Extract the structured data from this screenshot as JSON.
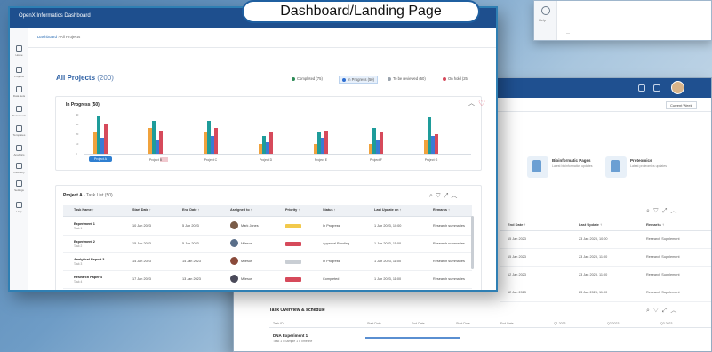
{
  "annotation": {
    "label": "Dashboard/Landing Page"
  },
  "top_window": {
    "side_label": "Help",
    "text_line1": "",
    "text_line2": ""
  },
  "app": {
    "brand": "OpenX Informatics Dashboard",
    "breadcrumb_root": "Dashboard",
    "breadcrumb_current": "All Projects"
  },
  "sidebar": {
    "items": [
      {
        "label": "Home",
        "icon": "home-icon"
      },
      {
        "label": "Projects",
        "icon": "projects-icon"
      },
      {
        "label": "Data Sets",
        "icon": "dataset-icon"
      },
      {
        "label": "Documents",
        "icon": "documents-icon"
      },
      {
        "label": "Templates",
        "icon": "templates-icon"
      },
      {
        "label": "Analytics",
        "icon": "analytics-icon"
      },
      {
        "label": "Inventory",
        "icon": "inventory-icon"
      },
      {
        "label": "Settings",
        "icon": "settings-icon"
      },
      {
        "label": "Help",
        "icon": "help-icon"
      }
    ]
  },
  "main": {
    "title": "All Projects",
    "title_count": "(200)",
    "legend": [
      {
        "label": "Completed (75)",
        "color": "#2e8b57"
      },
      {
        "label": "In Progress (50)",
        "color": "#2f6fd1",
        "active": true
      },
      {
        "label": "To be reviewed (50)",
        "color": "#9aa3ad"
      },
      {
        "label": "On hold (25)",
        "color": "#d64a5b"
      }
    ]
  },
  "chart_data": {
    "type": "bar",
    "title": "In Progress (50)",
    "ylabel": "",
    "categories": [
      "Project A",
      "Project B",
      "Project C",
      "Project D",
      "Project E",
      "Project F",
      "Project G"
    ],
    "series": [
      {
        "color": "#f0a23c",
        "values": [
          22,
          26,
          22,
          10,
          10,
          10,
          15
        ]
      },
      {
        "color": "#1e9c9a",
        "values": [
          38,
          34,
          34,
          18,
          22,
          26,
          37
        ]
      },
      {
        "color": "#3a7bd5",
        "values": [
          16,
          14,
          18,
          12,
          16,
          14,
          18
        ]
      },
      {
        "color": "#d64a5b",
        "values": [
          30,
          24,
          26,
          22,
          24,
          22,
          20
        ]
      }
    ],
    "ylim": [
      0,
      40
    ],
    "yticks": [
      40,
      30,
      20,
      10,
      0
    ],
    "selected_category": "Project A"
  },
  "table": {
    "title": "Project A",
    "title_sub": "- Task List (50)",
    "columns": [
      "Task Name ↑",
      "Start Date ↑",
      "End Date ↑",
      "Assigned to ↑",
      "Priority ↑",
      "Status ↑",
      "Last Update on ↑",
      "Remarks ↑"
    ],
    "rows": [
      {
        "name": "Experiment 1",
        "sub": "Task 1",
        "start": "10 Jan 2023",
        "end": "5 Jan 2023",
        "assignee": "Mark Jones",
        "priority_color": "#f2c94c",
        "status": "In Progress",
        "updated": "1 Jan 2023, 10:00",
        "remarks": "Research summaries",
        "avatar": "#7a5c48"
      },
      {
        "name": "Experiment 2",
        "sub": "Task 2",
        "start": "15 Jan 2023",
        "end": "5 Jan 2023",
        "assignee": "Milesus",
        "priority_color": "#d64a5b",
        "status": "Approval Pending",
        "updated": "1 Jan 2023, 11:00",
        "remarks": "Research summaries",
        "avatar": "#5a6f8a"
      },
      {
        "name": "Analytical Report 3",
        "sub": "Task 3",
        "start": "14 Jan 2023",
        "end": "14 Jan 2023",
        "assignee": "Milesus",
        "priority_color": "#c9ced4",
        "status": "In Progress",
        "updated": "1 Jan 2023, 11:00",
        "remarks": "Research summaries",
        "avatar": "#8a4a3a"
      },
      {
        "name": "Research Paper 4",
        "sub": "Task 4",
        "start": "17 Jan 2023",
        "end": "13 Jan 2023",
        "assignee": "Milesus",
        "priority_color": "#d64a5b",
        "status": "Completed",
        "updated": "1 Jan 2023, 11:00",
        "remarks": "Research summaries",
        "avatar": "#4a4a5a"
      }
    ]
  },
  "back_window": {
    "select": "Current Week",
    "cards": [
      {
        "title": "Bioinformatic Pages",
        "sub": "Latest bioinformatics updates"
      },
      {
        "title": "Proteomics",
        "sub": "Latest proteomics updates"
      }
    ],
    "table_head": [
      "End Date ↑",
      "Last Update ↑",
      "Remarks ↑"
    ],
    "rows": [
      {
        "c1": "15 Jan 2023",
        "c2": "23 Jan 2023, 10:00",
        "c3": "Research Supplement"
      },
      {
        "c1": "15 Jan 2023",
        "c2": "23 Jan 2023, 11:00",
        "c3": "Research Supplement"
      },
      {
        "c1": "12 Jan 2023",
        "c2": "23 Jan 2023, 11:00",
        "c3": "Research Supplement"
      },
      {
        "c1": "12 Jan 2023",
        "c2": "23 Jan 2023, 11:00",
        "c3": "Research Supplement"
      }
    ],
    "gantt": {
      "title": "Task Overview & schedule",
      "head": [
        "Task ID",
        "Start Date",
        "End Date",
        "Start Date",
        "End Date",
        "Q1 2023",
        "Q2 2023",
        "Q3 2023"
      ],
      "row_name": "DNA Experiment 1",
      "row_sub": "Task 1 • Sample 1 • Timeline"
    }
  }
}
